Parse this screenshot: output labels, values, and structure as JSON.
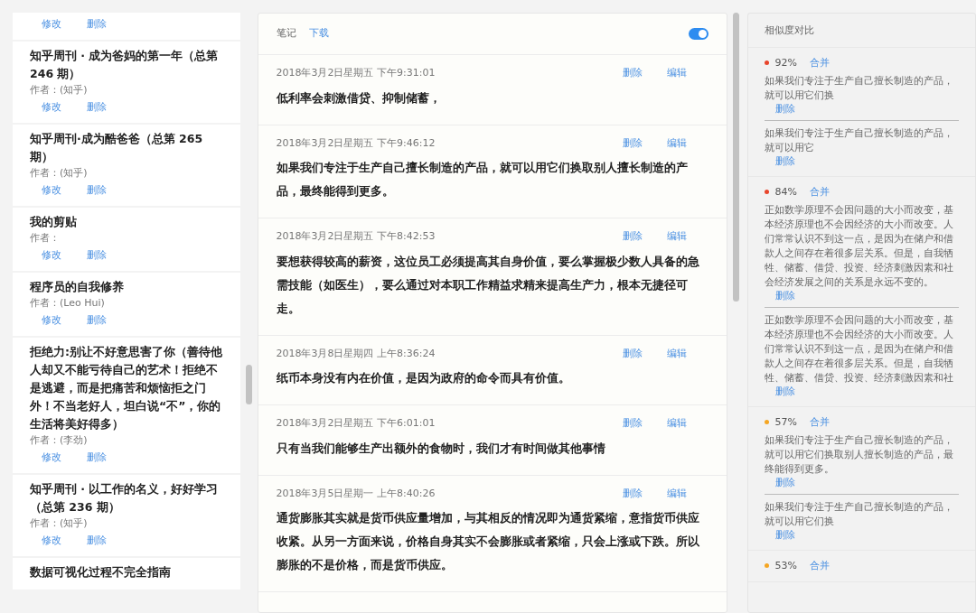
{
  "articles": [
    {
      "actions": [
        "修改",
        "删除"
      ]
    },
    {
      "title": "知乎周刊 · 成为爸妈的第一年（总第 246 期）",
      "author": "作者：(知乎)",
      "actions": [
        "修改",
        "删除"
      ]
    },
    {
      "title": "知乎周刊·成为酷爸爸（总第 265 期）",
      "author": "作者：(知乎)",
      "actions": [
        "修改",
        "删除"
      ]
    },
    {
      "title": "我的剪贴",
      "author": "作者：",
      "actions": [
        "修改",
        "删除"
      ]
    },
    {
      "title": "程序员的自我修养",
      "author": "作者：(Leo Hui)",
      "actions": [
        "修改",
        "删除"
      ]
    },
    {
      "title": "拒绝力:别让不好意思害了你（善待他人却又不能亏待自己的艺术！拒绝不是逃避，而是把痛苦和烦恼拒之门外！不当老好人，坦白说“不”，你的生活将美好得多）",
      "author": "作者：(李劲)",
      "actions": [
        "修改",
        "删除"
      ]
    },
    {
      "title": "知乎周刊 · 以工作的名义，好好学习（总第 236 期）",
      "author": "作者：(知乎)",
      "actions": [
        "修改",
        "删除"
      ]
    },
    {
      "title": "数据可视化过程不完全指南"
    }
  ],
  "notes": {
    "tabs": [
      {
        "label": "笔记",
        "selected": true
      },
      {
        "label": "下载",
        "selected": false
      }
    ],
    "toggle": {
      "on": true
    },
    "entries": [
      {
        "time": "2018年3月2日星期五 下午9:31:01",
        "text": "低利率会刺激借贷、抑制储蓄，",
        "actions": [
          "删除",
          "编辑"
        ]
      },
      {
        "time": "2018年3月2日星期五 下午9:46:12",
        "text": "如果我们专注于生产自己擅长制造的产品，就可以用它们换取别人擅长制造的产品，最终能得到更多。",
        "actions": [
          "删除",
          "编辑"
        ]
      },
      {
        "time": "2018年3月2日星期五 下午8:42:53",
        "text": "要想获得较高的薪资，这位员工必须提高其自身价值，要么掌握极少数人具备的急需技能（如医生），要么通过对本职工作精益求精来提高生产力，根本无捷径可走。",
        "actions": [
          "删除",
          "编辑"
        ]
      },
      {
        "time": "2018年3月8日星期四 上午8:36:24",
        "text": "纸币本身没有内在价值，是因为政府的命令而具有价值。",
        "actions": [
          "删除",
          "编辑"
        ]
      },
      {
        "time": "2018年3月2日星期五 下午6:01:01",
        "text": "只有当我们能够生产出额外的食物时，我们才有时间做其他事情",
        "actions": [
          "删除",
          "编辑"
        ]
      },
      {
        "time": "2018年3月5日星期一 上午8:40:26",
        "text": "通货膨胀其实就是货币供应量增加，与其相反的情况即为通货紧缩，意指货币供应收紧。从另一方面来说，价格自身其实不会膨胀或者紧缩，只会上涨或下跌。所以膨胀的不是价格，而是货币供应。",
        "actions": [
          "删除",
          "编辑"
        ]
      }
    ]
  },
  "similarity": {
    "title": "相似度对比",
    "groups": [
      {
        "percent": "92%",
        "color": "#e8452c",
        "merge": "合并",
        "items": [
          {
            "text": "如果我们专注于生产自己擅长制造的产品，就可以用它们换",
            "delete": "删除"
          },
          {
            "text": "如果我们专注于生产自己擅长制造的产品，就可以用它",
            "delete": "删除"
          }
        ]
      },
      {
        "percent": "84%",
        "color": "#e8452c",
        "merge": "合并",
        "items": [
          {
            "text": "正如数学原理不会因问题的大小而改变，基本经济原理也不会因经济的大小而改变。人们常常认识不到这一点，是因为在储户和借款人之间存在着很多层关系。但是，自我牺牲、储蓄、借贷、投资、经济刺激因素和社会经济发展之间的关系是永远不变的。",
            "delete": "删除"
          },
          {
            "text": "正如数学原理不会因问题的大小而改变，基本经济原理也不会因经济的大小而改变。人们常常认识不到这一点，是因为在储户和借款人之间存在着很多层关系。但是，自我牺牲、储蓄、借贷、投资、经济刺激因素和社",
            "delete": "删除"
          }
        ]
      },
      {
        "percent": "57%",
        "color": "#f5a623",
        "merge": "合并",
        "items": [
          {
            "text": "如果我们专注于生产自己擅长制造的产品，就可以用它们换取别人擅长制造的产品，最终能得到更多。",
            "delete": "删除"
          },
          {
            "text": "如果我们专注于生产自己擅长制造的产品，就可以用它们换",
            "delete": "删除"
          }
        ]
      },
      {
        "percent": "53%",
        "color": "#f5a623",
        "merge": "合并"
      }
    ]
  }
}
